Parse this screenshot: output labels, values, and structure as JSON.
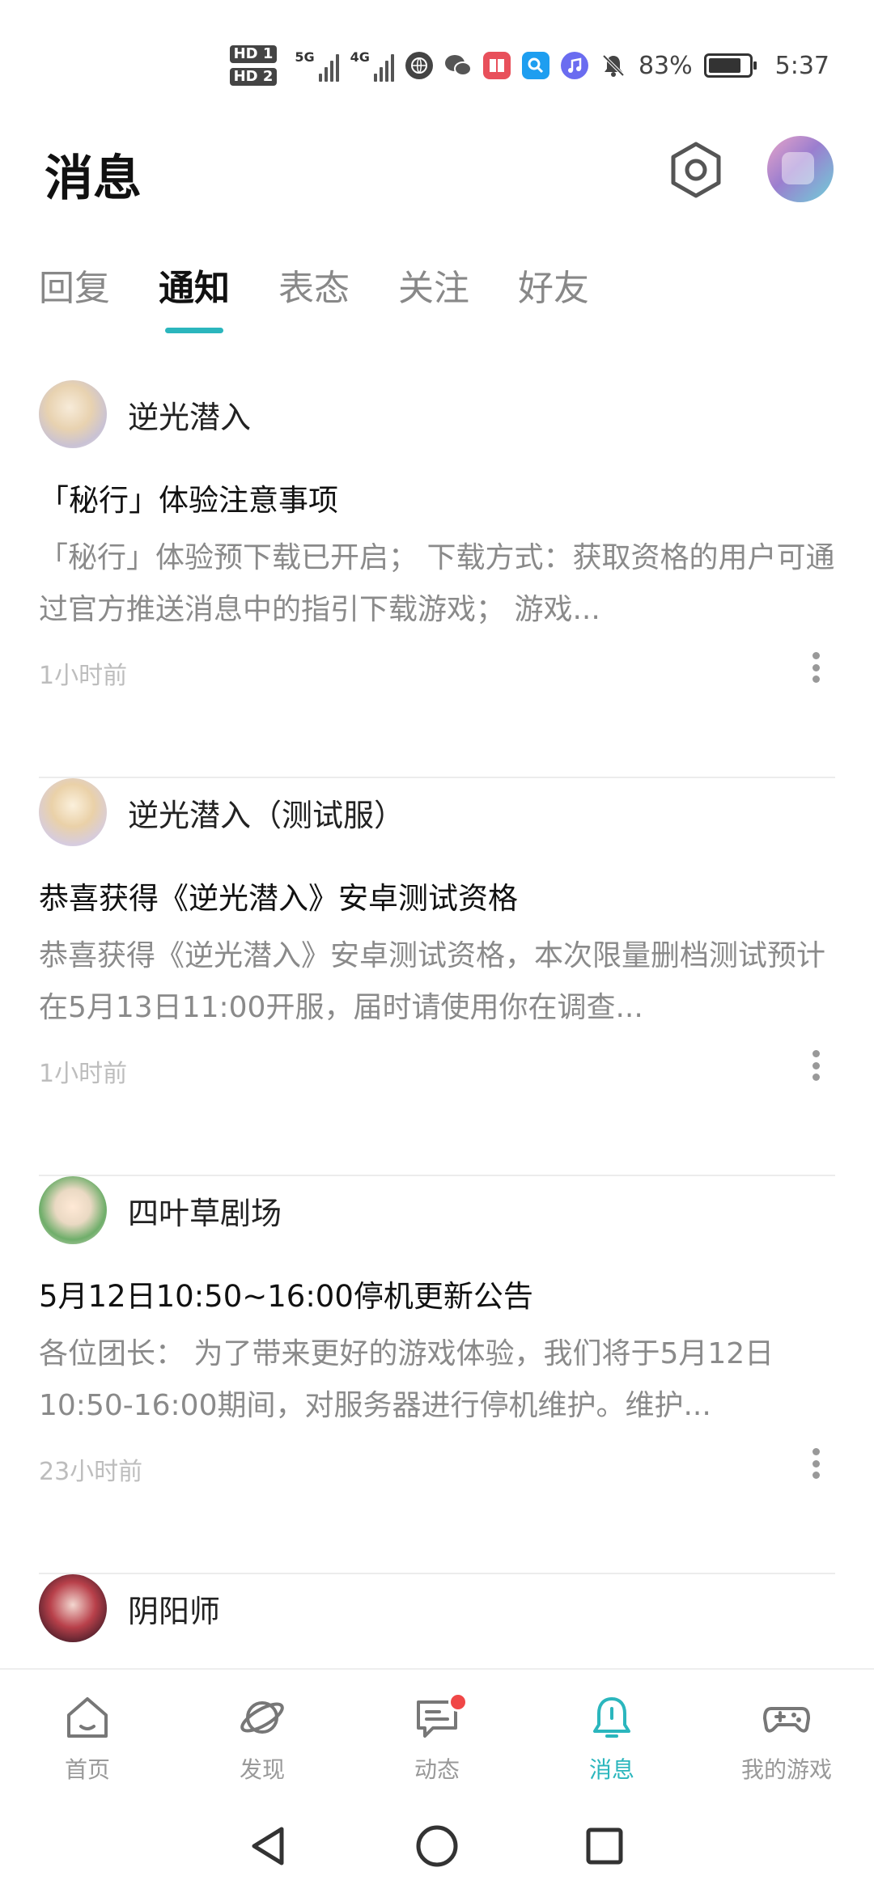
{
  "status_bar": {
    "hd1": "HD 1",
    "hd2": "HD 2",
    "net1": "5G",
    "net2": "4G",
    "battery_percent": "83%",
    "battery_level": 0.83,
    "time": "5:37",
    "icons": [
      "browser-icon",
      "wechat-icon",
      "reader-icon",
      "search-app-icon",
      "music-icon",
      "mute-bell-icon"
    ]
  },
  "header": {
    "title": "消息"
  },
  "tabs": [
    {
      "label": "回复",
      "active": false
    },
    {
      "label": "通知",
      "active": true
    },
    {
      "label": "表态",
      "active": false
    },
    {
      "label": "关注",
      "active": false
    },
    {
      "label": "好友",
      "active": false
    }
  ],
  "messages": [
    {
      "sender": "逆光潜入",
      "title": "「秘行」体验注意事项",
      "body": "「秘行」体验预下载已开启； 下载方式：获取资格的用户可通过官方推送消息中的指引下载游戏； 游戏...",
      "time": "1小时前"
    },
    {
      "sender": "逆光潜入（测试服）",
      "title": "恭喜获得《逆光潜入》安卓测试资格",
      "body": "恭喜获得《逆光潜入》安卓测试资格，本次限量删档测试预计在5月13日11:00开服，届时请使用你在调查...",
      "time": "1小时前"
    },
    {
      "sender": "四叶草剧场",
      "title": "5月12日10:50~16:00停机更新公告",
      "body": "各位团长： 为了带来更好的游戏体验，我们将于5月12日10:50-16:00期间，对服务器进行停机维护。维护...",
      "time": "23小时前"
    },
    {
      "sender": "阴阳师",
      "title": "",
      "body": "",
      "time": ""
    }
  ],
  "bottom_nav": [
    {
      "label": "首页",
      "icon": "home-icon",
      "active": false,
      "badge": false
    },
    {
      "label": "发现",
      "icon": "planet-icon",
      "active": false,
      "badge": false
    },
    {
      "label": "动态",
      "icon": "chat-icon",
      "active": false,
      "badge": true
    },
    {
      "label": "消息",
      "icon": "bell-icon",
      "active": true,
      "badge": false
    },
    {
      "label": "我的游戏",
      "icon": "gamepad-icon",
      "active": false,
      "badge": false
    }
  ],
  "colors": {
    "accent": "#2bb6bd",
    "badge": "#f04747"
  }
}
